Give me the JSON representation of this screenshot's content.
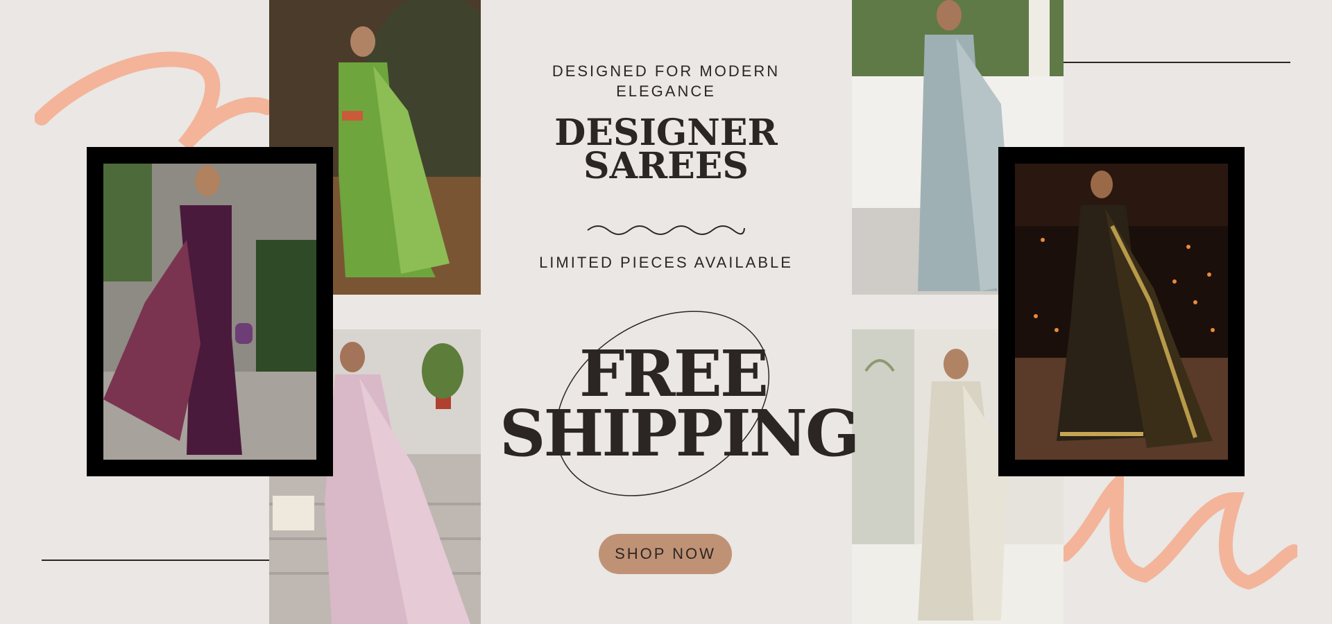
{
  "banner": {
    "tagline": "DESIGNED FOR MODERN ELEGANCE",
    "heading_line1": "DESIGNER",
    "heading_line2": "SAREES",
    "subtext": "LIMITED PIECES AVAILABLE",
    "promo_line1": "FREE",
    "promo_line2": "SHIPPING",
    "cta_label": "SHOP NOW"
  },
  "colors": {
    "background": "#eae7e4",
    "text": "#2b2624",
    "accent_brush": "#f3b49a",
    "button": "#c09275",
    "frame": "#000000"
  },
  "photos": [
    {
      "name": "purple-saree-photo",
      "saree_color": "#4a1a3c"
    },
    {
      "name": "green-saree-photo",
      "saree_color": "#6ea53c"
    },
    {
      "name": "pink-saree-photo",
      "saree_color": "#d9b8c8"
    },
    {
      "name": "grey-blue-saree-photo",
      "saree_color": "#9fb0b4"
    },
    {
      "name": "black-gold-saree-photo",
      "saree_color": "#2a2216"
    },
    {
      "name": "ivory-saree-photo",
      "saree_color": "#d8d3c2"
    }
  ]
}
